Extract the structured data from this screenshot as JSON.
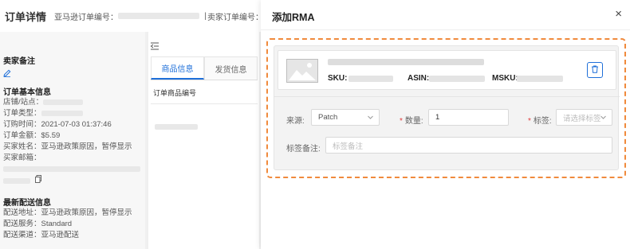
{
  "order_panel": {
    "title": "订单详情",
    "amazon_order_label": "亚马逊订单编号：",
    "seller_order_label": "卖家订单编号：",
    "sep": "|"
  },
  "seller_notes": {
    "heading": "卖家备注",
    "edit_icon": "pencil-icon"
  },
  "basic_info": {
    "heading": "订单基本信息",
    "shop_label": "店铺/站点：",
    "type_label": "订单类型：",
    "time_label": "订购时间：",
    "time_value": "2021-07-03 01:37:46",
    "amount_label": "订单金额：",
    "amount_value": "$5.59",
    "buyer_name_label": "买家姓名：",
    "buyer_name_value": "亚马逊政策原因，暂停显示",
    "buyer_email_label": "买家邮箱："
  },
  "shipping_info": {
    "heading": "最新配送信息",
    "address_label": "配送地址：",
    "address_value": "亚马逊政策原因，暂停显示",
    "service_label": "配送服务：",
    "service_value": "Standard",
    "channel_label": "配送渠道：",
    "channel_value": "亚马逊配送"
  },
  "tabs": {
    "product": "商品信息",
    "shipping": "发货信息",
    "column_header": "订单商品编号"
  },
  "dialog": {
    "title": "添加RMA",
    "close": "×"
  },
  "product": {
    "sku_label": "SKU:",
    "asin_label": "ASIN:",
    "msku_label": "MSKU:"
  },
  "form": {
    "source_label": "来源:",
    "source_value": "Patch",
    "quantity_label": "数量:",
    "quantity_value": "1",
    "tag_label": "标签:",
    "tag_placeholder": "请选择标签",
    "tag_note_label": "标签备注:",
    "tag_note_placeholder": "标签备注"
  },
  "colors": {
    "accent": "#1e6fd9",
    "required": "#e03c3c",
    "highlight_dash": "#f08a3c"
  }
}
